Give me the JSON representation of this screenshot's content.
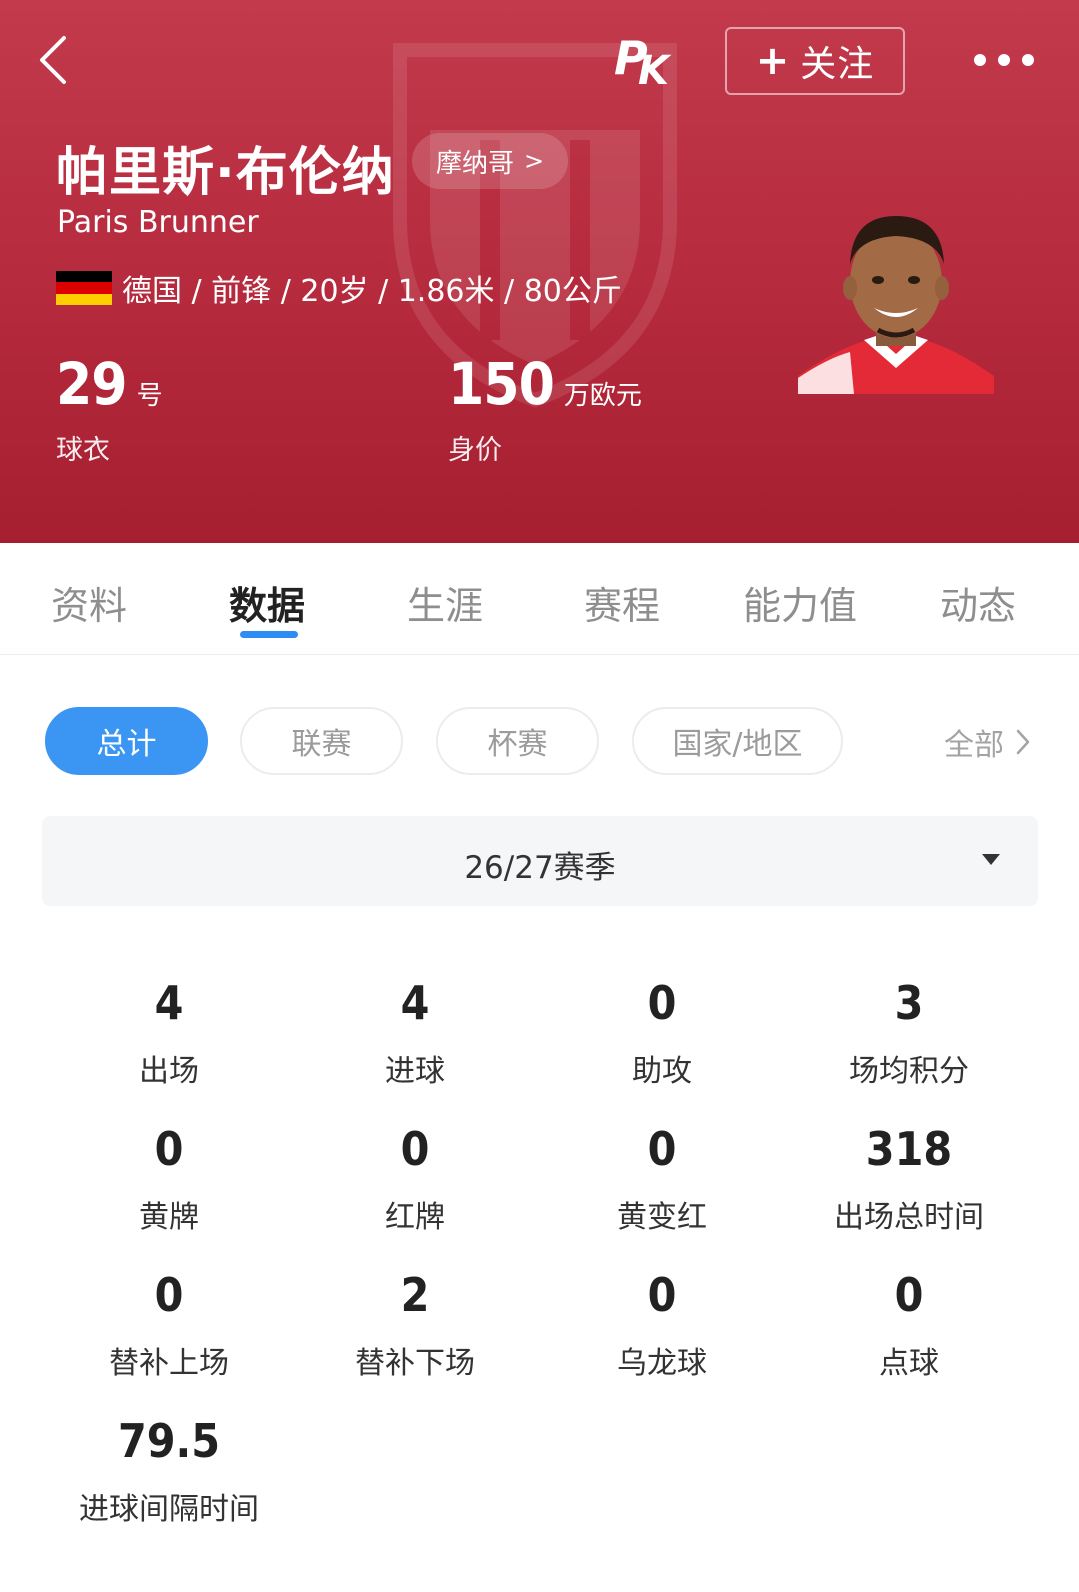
{
  "header": {
    "player_name": "帕里斯·布伦纳",
    "player_name_en": "Paris Brunner",
    "club": "摩纳哥",
    "club_chevron": ">",
    "follow_label": "关注",
    "follow_plus": "+",
    "meta": "德国 / 前锋 / 20岁 / 1.86米 / 80公斤",
    "jersey_number": "29",
    "jersey_unit": "号",
    "jersey_caption": "球衣",
    "market_value": "150",
    "market_value_unit": "万欧元",
    "market_value_caption": "身价",
    "brand_color": "#b52a3c"
  },
  "tabs": [
    {
      "label": "资料",
      "active": false
    },
    {
      "label": "数据",
      "active": true
    },
    {
      "label": "生涯",
      "active": false
    },
    {
      "label": "赛程",
      "active": false
    },
    {
      "label": "能力值",
      "active": false
    },
    {
      "label": "动态",
      "active": false
    }
  ],
  "filters": {
    "pills": [
      {
        "label": "总计",
        "active": true
      },
      {
        "label": "联赛",
        "active": false
      },
      {
        "label": "杯赛",
        "active": false
      },
      {
        "label": "国家/地区",
        "active": false
      }
    ],
    "more_label": "全部",
    "accent_color": "#3a95f3"
  },
  "season": {
    "selected": "26/27赛季"
  },
  "stats": [
    {
      "value": "4",
      "label": "出场"
    },
    {
      "value": "4",
      "label": "进球"
    },
    {
      "value": "0",
      "label": "助攻"
    },
    {
      "value": "3",
      "label": "场均积分"
    },
    {
      "value": "0",
      "label": "黄牌"
    },
    {
      "value": "0",
      "label": "红牌"
    },
    {
      "value": "0",
      "label": "黄变红"
    },
    {
      "value": "318",
      "label": "出场总时间"
    },
    {
      "value": "0",
      "label": "替补上场"
    },
    {
      "value": "2",
      "label": "替补下场"
    },
    {
      "value": "0",
      "label": "乌龙球"
    },
    {
      "value": "0",
      "label": "点球"
    },
    {
      "value": "79.5",
      "label": "进球间隔时间"
    }
  ]
}
